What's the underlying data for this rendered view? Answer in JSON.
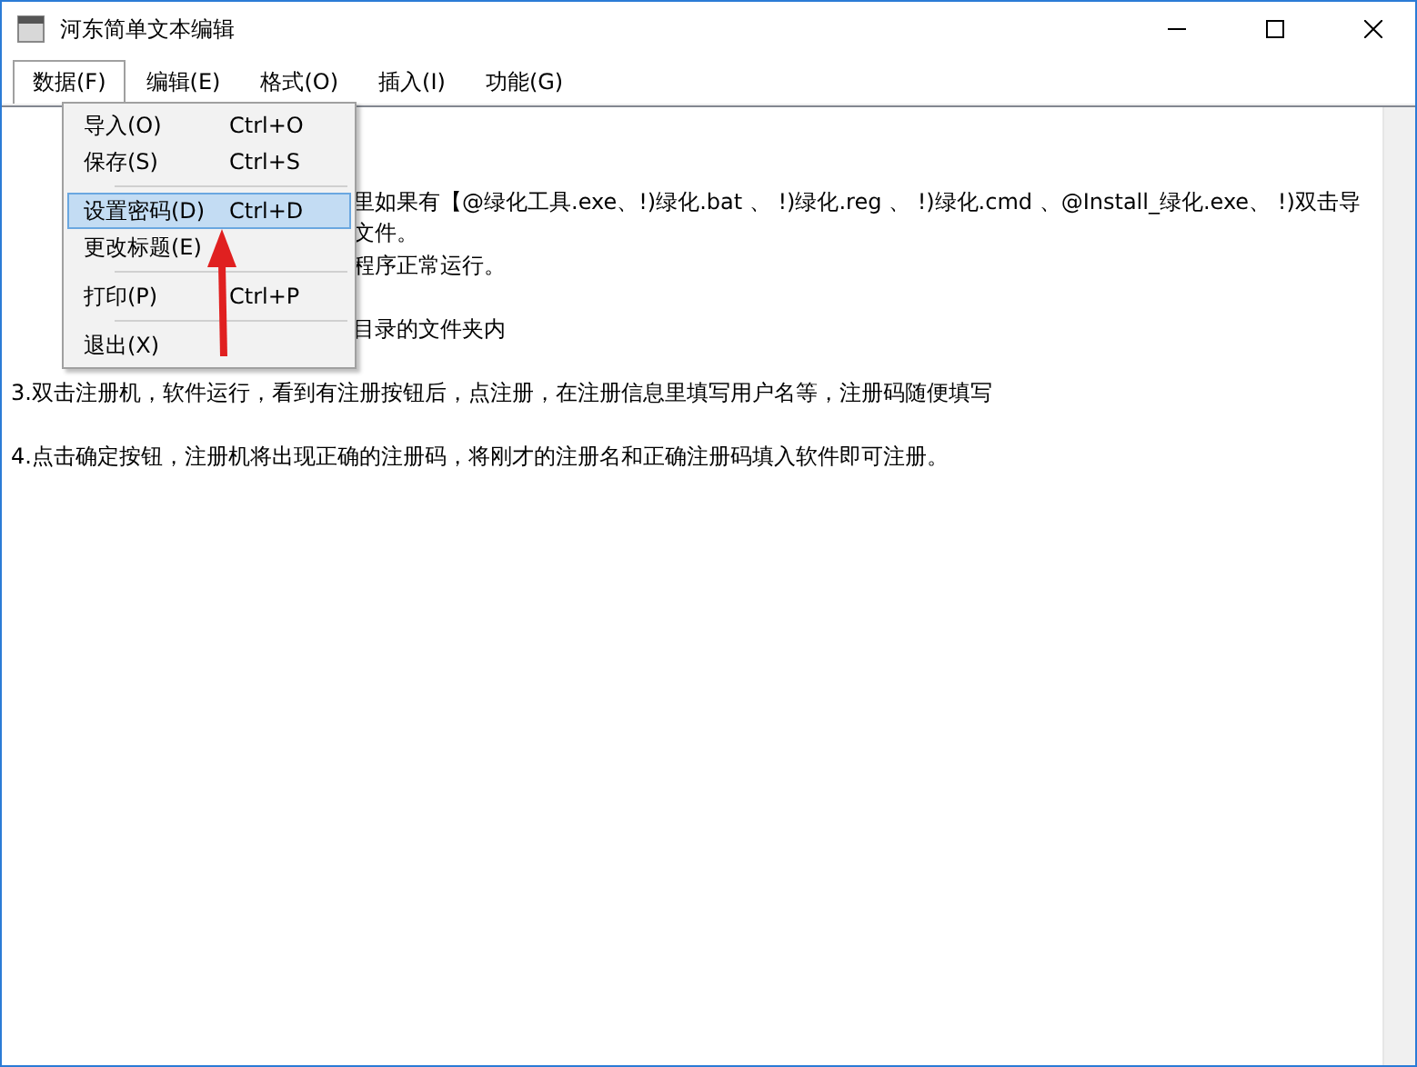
{
  "window": {
    "title": "河东简单文本编辑"
  },
  "menubar": [
    {
      "label": "数据(F)",
      "selected": true
    },
    {
      "label": "编辑(E)",
      "selected": false
    },
    {
      "label": "格式(O)",
      "selected": false
    },
    {
      "label": "插入(I)",
      "selected": false
    },
    {
      "label": "功能(G)",
      "selected": false
    }
  ],
  "dropdown": [
    {
      "kind": "item",
      "label": "导入(O)",
      "shortcut": "Ctrl+O",
      "selected": false
    },
    {
      "kind": "item",
      "label": "保存(S)",
      "shortcut": "Ctrl+S",
      "selected": false
    },
    {
      "kind": "separator"
    },
    {
      "kind": "item",
      "label": "设置密码(D)",
      "shortcut": "Ctrl+D",
      "selected": true
    },
    {
      "kind": "item",
      "label": "更改标题(E)",
      "selected": false
    },
    {
      "kind": "separator"
    },
    {
      "kind": "item",
      "label": "打印(P)",
      "shortcut": "Ctrl+P",
      "selected": false
    },
    {
      "kind": "separator"
    },
    {
      "kind": "item",
      "label": "退出(X)",
      "selected": false
    }
  ],
  "editor_lines": [
    {
      "kind": "blank"
    },
    {
      "kind": "partial",
      "text": "里如果有【@绿化工具.exe、!)绿化.bat 、 !)绿化.reg 、 !)绿化.cmd 、@Install_绿化.exe、 !)双击导"
    },
    {
      "kind": "partial",
      "text": "文件。"
    },
    {
      "kind": "partial",
      "text": "程序正常运行。"
    },
    {
      "kind": "blank"
    },
    {
      "kind": "partial",
      "text": "目录的文件夹内"
    },
    {
      "kind": "blank"
    },
    {
      "kind": "full",
      "text": "3.双击注册机，软件运行，看到有注册按钮后，点注册，在注册信息里填写用户名等，注册码随便填写"
    },
    {
      "kind": "blank"
    },
    {
      "kind": "full",
      "text": "4.点击确定按钮，注册机将出现正确的注册码，将刚才的注册名和正确注册码填入软件即可注册。"
    }
  ]
}
